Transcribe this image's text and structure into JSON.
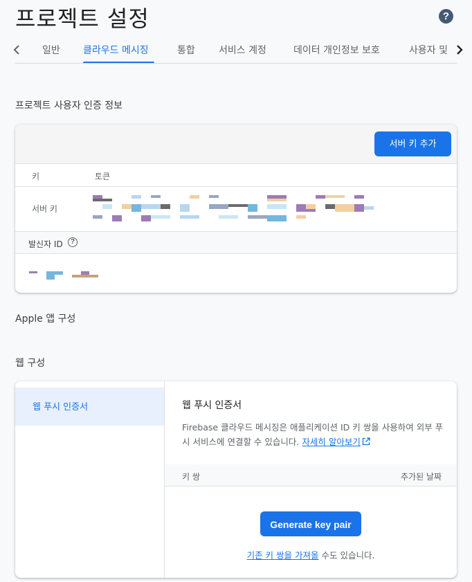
{
  "page": {
    "title": "프로젝트 설정",
    "help_icon": "help-icon"
  },
  "tabs": [
    {
      "label": "일반"
    },
    {
      "label": "클라우드 메시징",
      "active": true
    },
    {
      "label": "통합"
    },
    {
      "label": "서비스 계정"
    },
    {
      "label": "데이터 개인정보 보호"
    },
    {
      "label": "사용자 및"
    }
  ],
  "project_credentials": {
    "section_title": "프로젝트 사용자 인증 정보",
    "add_server_key_label": "서버 키 추가",
    "table_headers": {
      "key": "키",
      "token": "토큰"
    },
    "server_key_label": "서버 키",
    "sender_id_label": "발신자 ID"
  },
  "apple_section_title": "Apple 앱 구성",
  "web_section_title": "웹 구성",
  "web_push": {
    "sidebar_item": "웹 푸시 인증서",
    "title": "웹 푸시 인증서",
    "description": "Firebase 클라우드 메시징은 애플리케이션 ID 키 쌍을 사용하여 외부 푸시 서비스에 연결할 수 있습니다. ",
    "learn_more": "자세히 알아보기",
    "headers": {
      "key_pair": "키 쌍",
      "date_added": "추가된 날짜"
    },
    "generate_label": "Generate key pair",
    "import_link": "기존 키 쌍을 가져올",
    "import_suffix": " 수도 있습니다."
  },
  "colors": {
    "accent": "#1a73e8",
    "help_icon_bg": "#455a74"
  }
}
